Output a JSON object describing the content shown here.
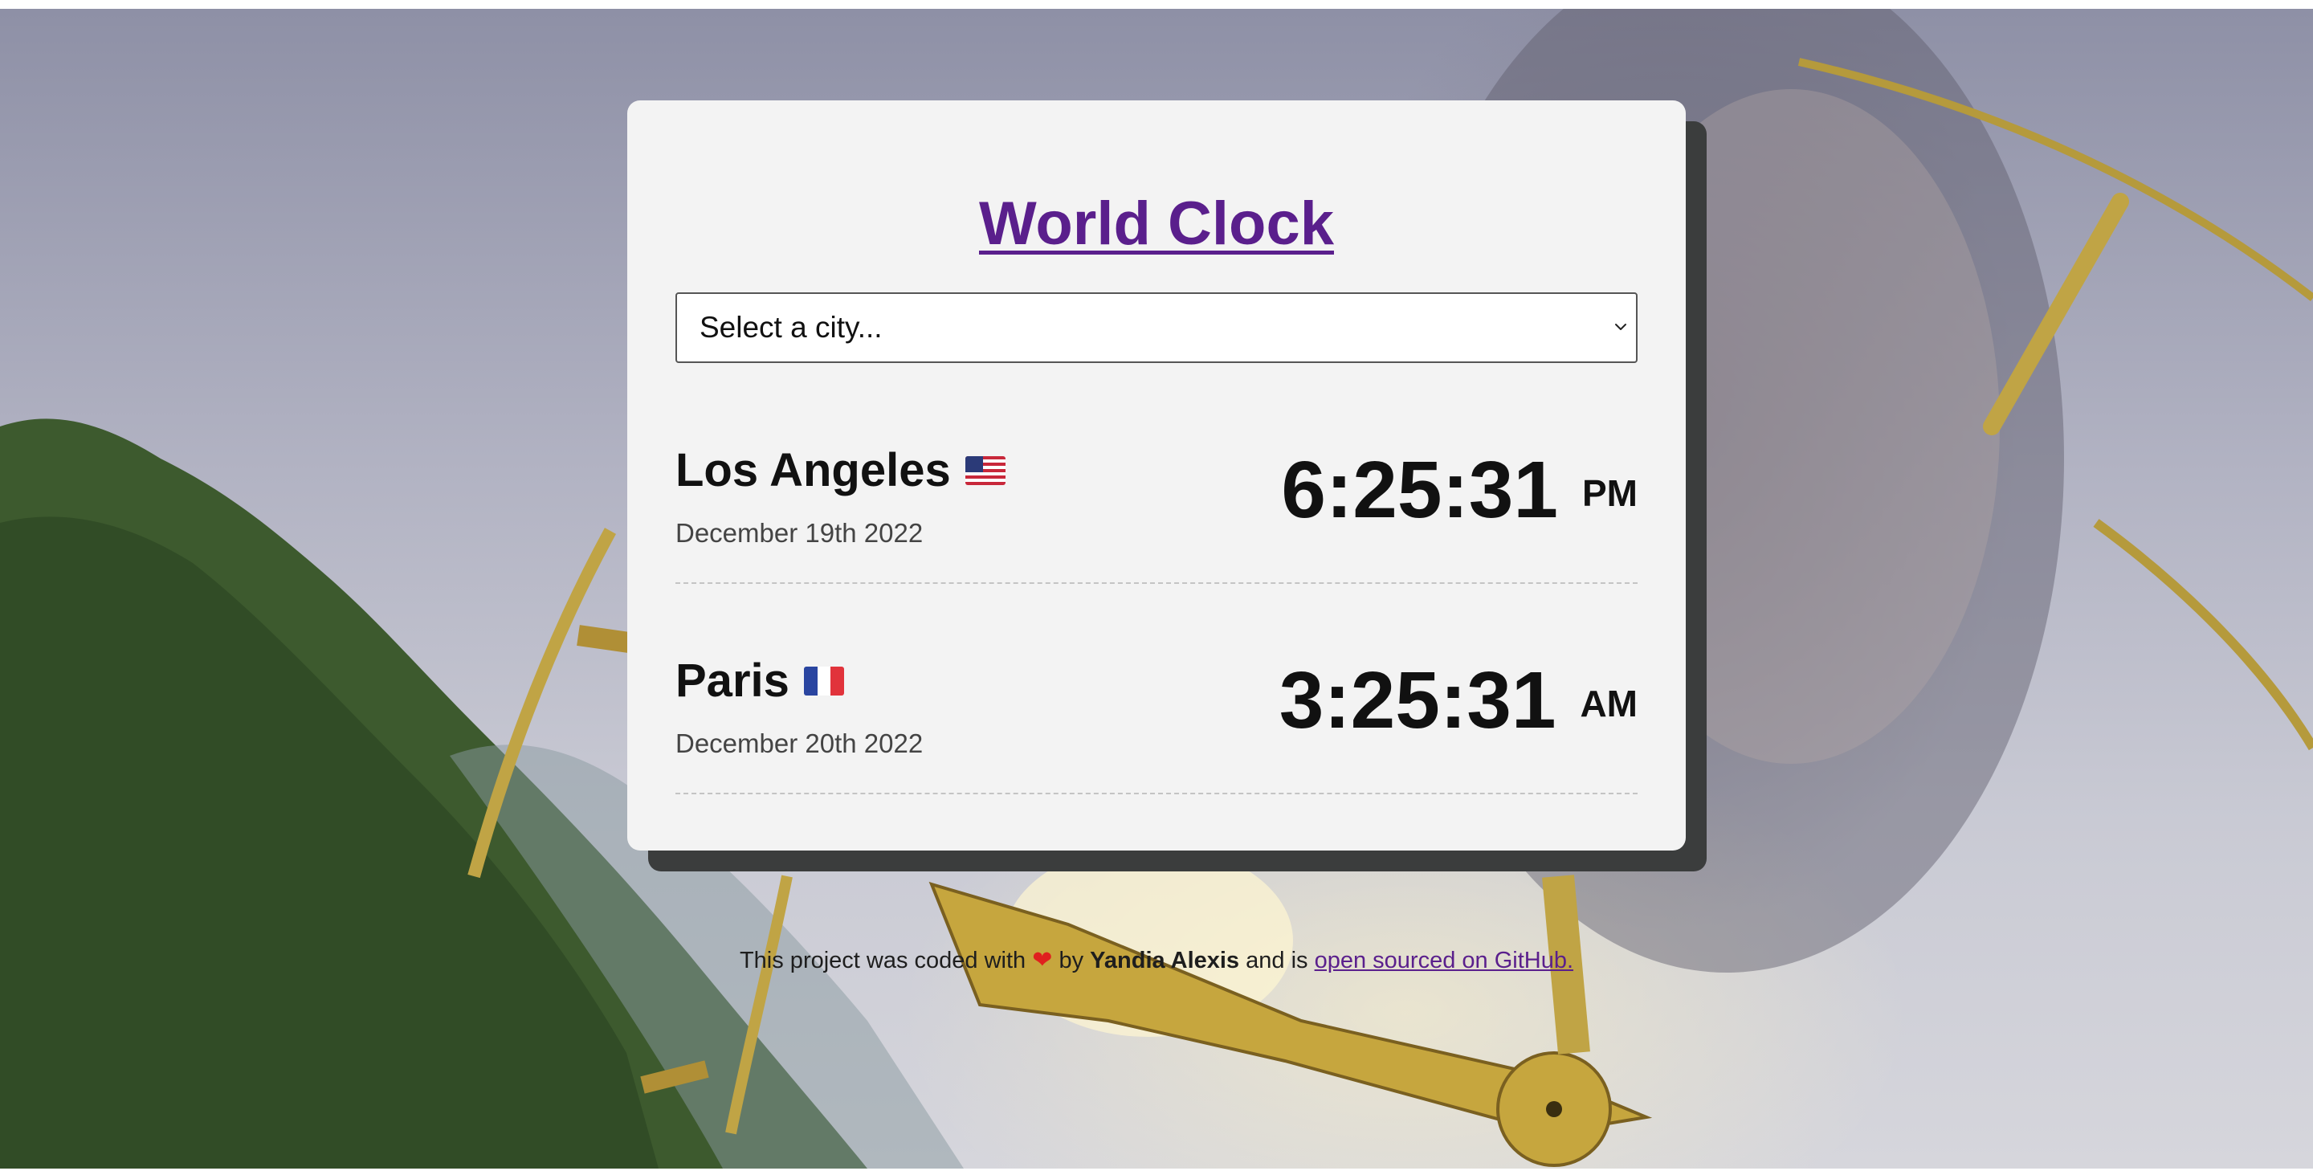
{
  "app": {
    "title": "World Clock"
  },
  "city_select": {
    "placeholder": "Select a city..."
  },
  "cities": [
    {
      "name": "Los Angeles",
      "flag_icon": "us-flag-icon",
      "date": "December 19th 2022",
      "time": "6:25:31",
      "ampm": "PM"
    },
    {
      "name": "Paris",
      "flag_icon": "france-flag-icon",
      "date": "December 20th 2022",
      "time": "3:25:31",
      "ampm": "AM"
    }
  ],
  "footer": {
    "prefix": "This project was coded with",
    "heart_icon": "heart-icon",
    "by": "by",
    "author": "Yandia Alexis",
    "middle": "and is",
    "link_text": "open sourced on GitHub."
  },
  "colors": {
    "title": "#5a1f8c",
    "card": "#f3f3f3",
    "card_shadow": "#3b3d3d",
    "link": "#5a1f8c"
  }
}
